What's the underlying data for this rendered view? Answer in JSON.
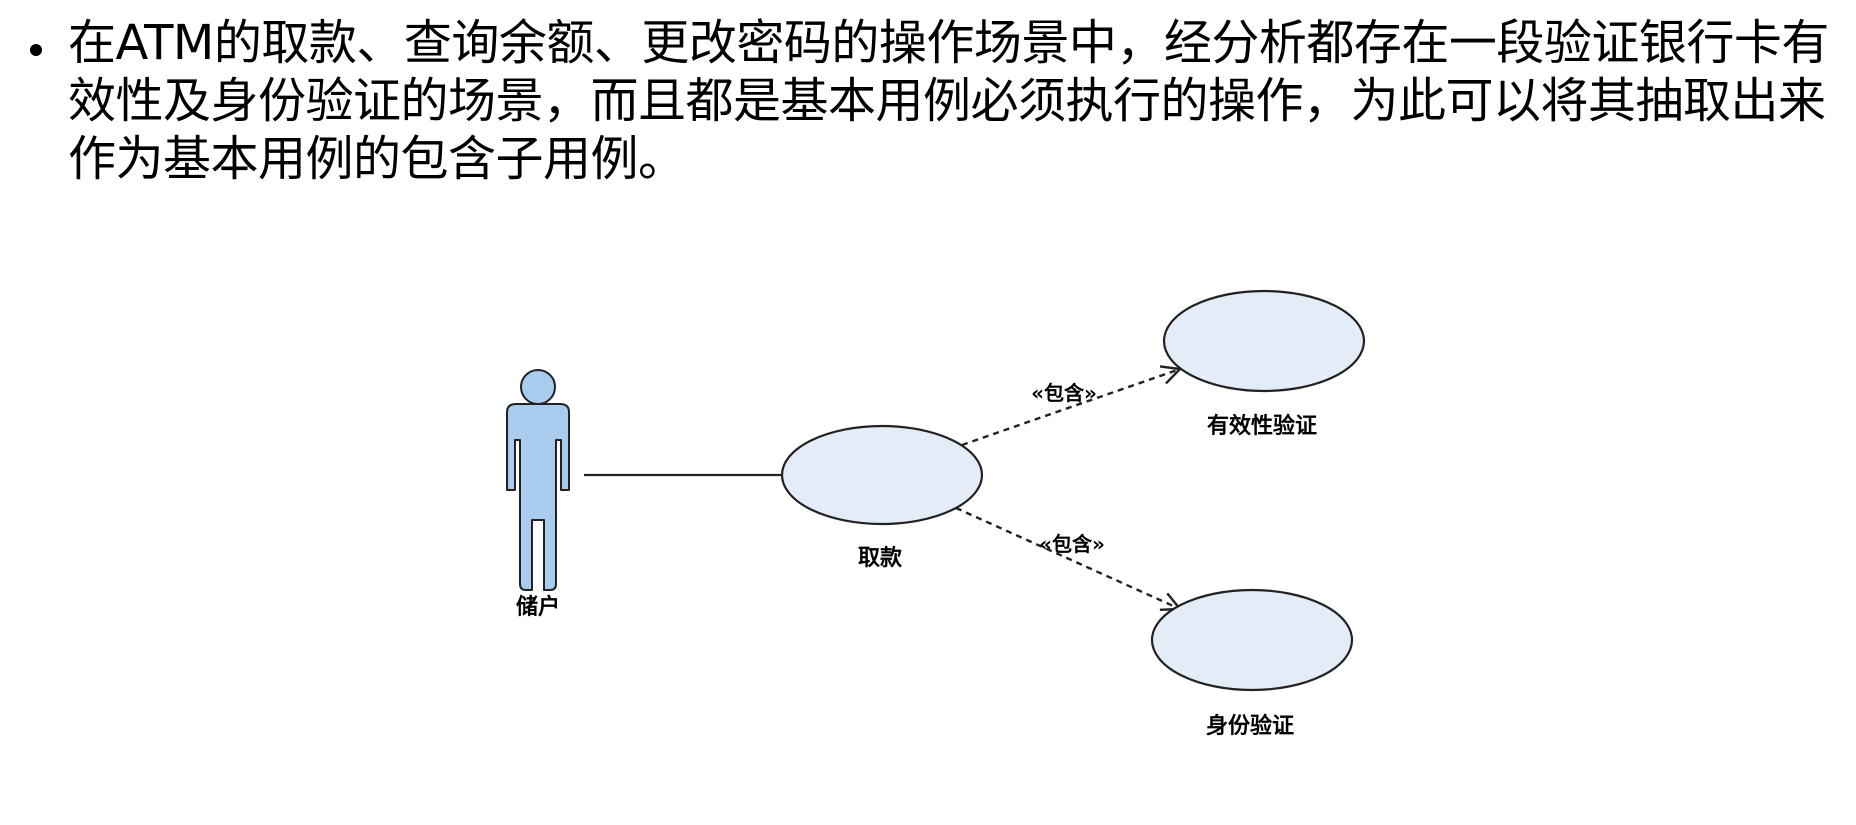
{
  "slide": {
    "bullet_text": "在ATM的取款、查询余额、更改密码的操作场景中，经分析都存在一段验证银行卡有效性及身份验证的场景，而且都是基本用例必须执行的操作，为此可以将其抽取出来作为基本用例的包含子用例。"
  },
  "diagram": {
    "actor": {
      "label": "储户",
      "icon": "stick-figure-icon",
      "fill": "#a9cbed"
    },
    "base_use_case": {
      "label": "取款",
      "fill": "#e3ecf7"
    },
    "included_use_cases": [
      {
        "label": "有效性验证",
        "fill": "#e3ecf7"
      },
      {
        "label": "身份验证",
        "fill": "#e3ecf7"
      }
    ],
    "include_stereotype": "«包含»",
    "colors": {
      "line": "#222222",
      "ellipse_fill": "#e3ecf7",
      "actor_fill": "#a9cbed"
    }
  }
}
